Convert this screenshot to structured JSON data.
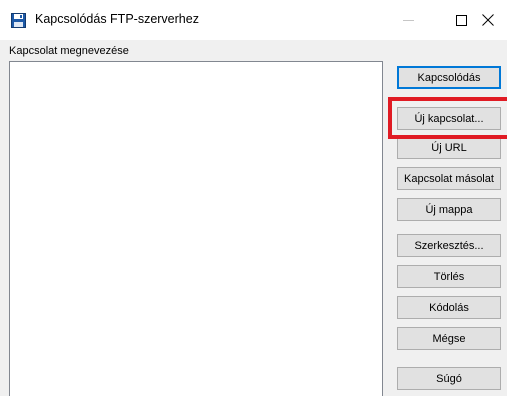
{
  "window": {
    "title": "Kapcsolódás FTP-szerverhez",
    "app_icon": "save-disk-icon",
    "caption": {
      "minimize": "—",
      "maximize": "☐",
      "close": "✕"
    }
  },
  "list": {
    "label": "Kapcsolat megnevezése",
    "items": []
  },
  "buttons": {
    "connect": "Kapcsolódás",
    "new_connection": "Új kapcsolat...",
    "new_url": "Új URL",
    "copy_connection": "Kapcsolat másolat",
    "new_folder": "Új mappa",
    "edit": "Szerkesztés...",
    "delete": "Törlés",
    "encoding": "Kódolás",
    "cancel": "Mégse",
    "help": "Súgó"
  },
  "annotation": {
    "highlight_color": "#e01b24",
    "highlighted_button": "new_connection"
  }
}
